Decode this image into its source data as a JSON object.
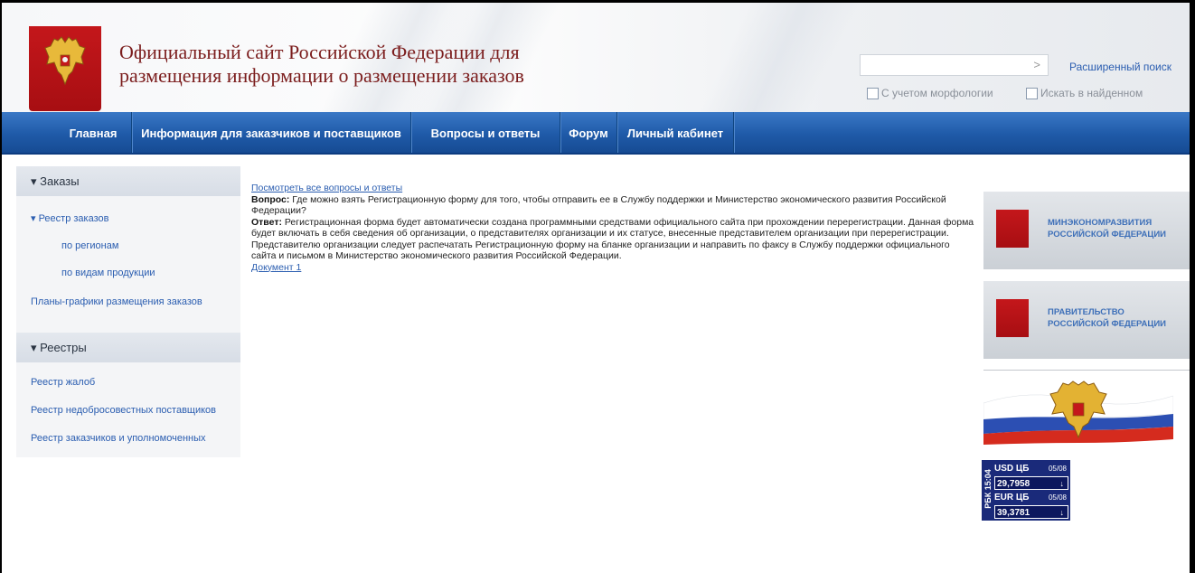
{
  "header": {
    "title_line1": "Официальный сайт Российской Федерации для",
    "title_line2": "размещения информации о размещении заказов",
    "search_value": "",
    "advanced_search": "Расширенный поиск",
    "morphology_label": "С учетом морфологии",
    "search_found_label": "Искать в найденном"
  },
  "nav": {
    "items": [
      "Главная",
      "Информация для заказчиков и поставщиков",
      "Вопросы и ответы",
      "Форум",
      "Личный кабинет"
    ]
  },
  "sidebar": {
    "orders_header": "▾ Заказы",
    "orders_registry": "▾ Реестр заказов",
    "by_region": "по регионам",
    "by_product": "по видам продукции",
    "schedules": "Планы-графики размещения заказов",
    "registries_header": "▾ Реестры",
    "complaints": "Реестр жалоб",
    "unfair_suppliers": "Реестр недобросовестных поставщиков",
    "customers_registry": "Реестр заказчиков и уполномоченных"
  },
  "content": {
    "all_questions_link": "Посмотреть все вопросы и ответы",
    "question_label": "Вопрос:",
    "question_text": " Где можно взять Регистрационную форму для того, чтобы отправить ее в Службу поддержки и Министерство экономического развития Российской Федерации?",
    "answer_label": "Ответ:",
    "answer_text": " Регистрационная форма будет автоматически создана программными средствами официального сайта при прохождении перерегистрации. Данная форма будет включать в себя сведения об организации, о представителях организации и их статусе, внесенные представителем организации при перерегистрации. Представителю организации следует распечатать Регистрационную форму на бланке организации и направить по факсу в Службу поддержки официального сайта и письмом в Министерство экономического развития Российской Федерации.",
    "document_link": "Документ 1"
  },
  "banners": {
    "ministry_line1": "МИНЭКОНОМРАЗВИТИЯ",
    "ministry_line2": "РОССИЙСКОЙ ФЕДЕРАЦИИ",
    "government_line1": "ПРАВИТЕЛЬСТВО",
    "government_line2": "РОССИЙСКОЙ ФЕДЕРАЦИИ"
  },
  "rbk": {
    "side_label": "РБК 15:04",
    "usd_label": "USD ЦБ",
    "usd_date": "05/08",
    "usd_value": "29,7958",
    "eur_label": "EUR ЦБ",
    "eur_date": "05/08",
    "eur_value": "39,3781",
    "trend": "↓"
  },
  "colors": {
    "nav_blue": "#1f5aa8",
    "title_red": "#7b1d1d",
    "link_blue": "#2a5db0",
    "rbk_navy": "#1a2a7a"
  }
}
